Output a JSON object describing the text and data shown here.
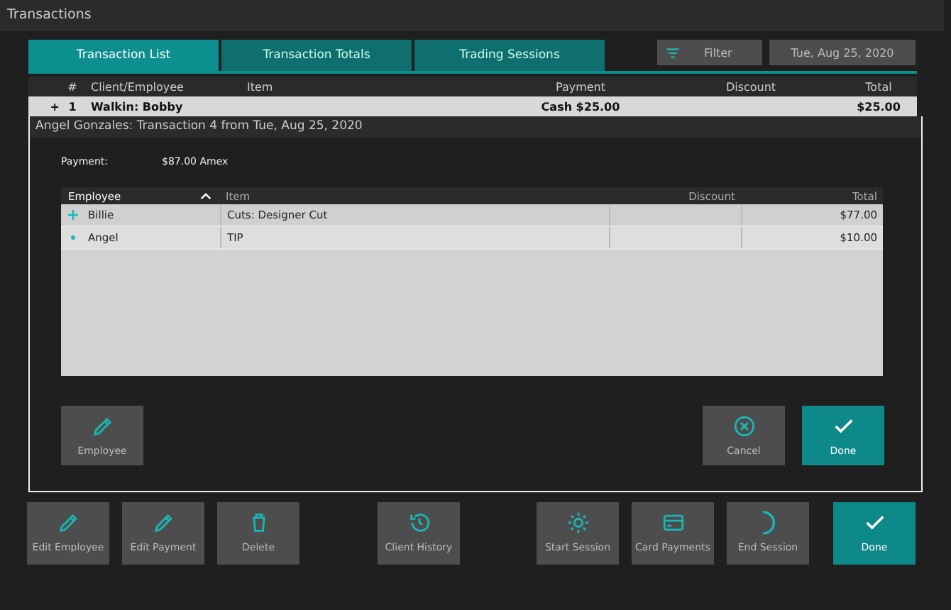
{
  "window": {
    "title": "Transactions"
  },
  "tabs": [
    {
      "label": "Transaction List",
      "selected": true
    },
    {
      "label": "Transaction Totals",
      "selected": false
    },
    {
      "label": "Trading Sessions",
      "selected": false
    }
  ],
  "filter_button": "Filter",
  "date_button": "Tue, Aug 25, 2020",
  "table": {
    "columns": [
      "#",
      "Client/Employee",
      "Item",
      "Payment",
      "Discount",
      "Total"
    ],
    "rows": [
      {
        "expander": "+",
        "cells": [
          "1",
          "Walkin: Bobby",
          "",
          "Cash $25.00",
          "",
          "$25.00"
        ]
      }
    ]
  },
  "dialog": {
    "title": "Angel Gonzales: Transaction 4 from Tue, Aug 25, 2020",
    "payment_label": "Payment:",
    "payment_value": "$87.00 Amex",
    "table": {
      "columns": [
        "Employee",
        "Item",
        "Discount",
        "Total"
      ],
      "rows": [
        {
          "kind": "plus",
          "cells": [
            "Billie",
            "Cuts: Designer Cut",
            "",
            "$77.00"
          ]
        },
        {
          "kind": "dot",
          "cells": [
            "Angel",
            "TIP",
            "",
            "$10.00"
          ]
        }
      ]
    },
    "buttons": [
      {
        "kind": "pencil",
        "label": "Employee",
        "primary": false
      },
      {
        "kind": "cancel",
        "label": "Cancel",
        "primary": false
      },
      {
        "kind": "check",
        "label": "Done",
        "primary": true
      }
    ]
  },
  "toolbar": [
    [
      {
        "kind": "pencil",
        "label": "Edit Employee",
        "primary": false
      },
      {
        "kind": "pencil",
        "label": "Edit Payment",
        "primary": false
      },
      {
        "kind": "trash",
        "label": "Delete",
        "primary": false
      }
    ],
    [
      {
        "kind": "history",
        "label": "Client History",
        "primary": false
      }
    ],
    [
      {
        "kind": "sun",
        "label": "Start Session",
        "primary": false
      },
      {
        "kind": "card",
        "label": "Card Payments",
        "primary": false
      },
      {
        "kind": "moon",
        "label": "End Session",
        "primary": false
      }
    ],
    [
      {
        "kind": "check",
        "label": "Done",
        "primary": true
      }
    ]
  ]
}
